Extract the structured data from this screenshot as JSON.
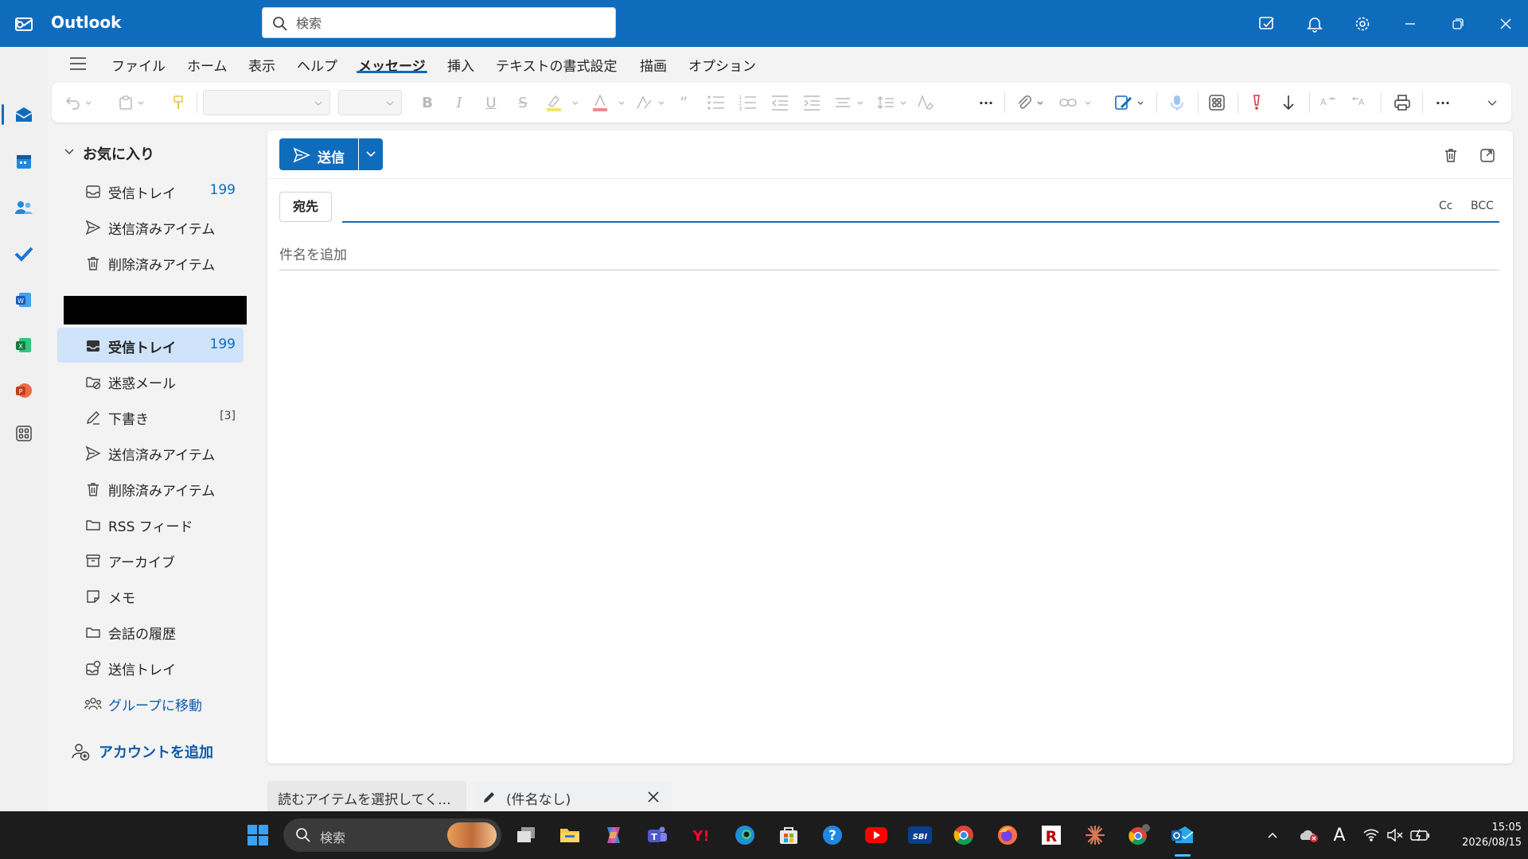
{
  "app": {
    "name": "Outlook",
    "accent": "#0f6cbd"
  },
  "search": {
    "placeholder": "検索"
  },
  "titlebar_buttons": [
    "compose-icon",
    "bell-icon",
    "gear-icon",
    "minimize-icon",
    "restore-icon",
    "close-icon"
  ],
  "rail": [
    "mail-icon",
    "calendar-icon",
    "people-icon",
    "todo-icon",
    "word-icon",
    "excel-icon",
    "powerpoint-icon",
    "apps-icon"
  ],
  "menu": {
    "tabs": [
      "ファイル",
      "ホーム",
      "表示",
      "ヘルプ",
      "メッセージ",
      "挿入",
      "テキストの書式設定",
      "描画",
      "オプション"
    ],
    "active": "メッセージ"
  },
  "folders": {
    "favorites_label": "お気に入り",
    "favorites": [
      {
        "label": "受信トレイ",
        "count": "199"
      },
      {
        "label": "送信済みアイテム"
      },
      {
        "label": "削除済みアイテム"
      }
    ],
    "account_items": [
      {
        "label": "受信トレイ",
        "count": "199",
        "selected": true
      },
      {
        "label": "迷惑メール"
      },
      {
        "label": "下書き",
        "count": "[3]"
      },
      {
        "label": "送信済みアイテム"
      },
      {
        "label": "削除済みアイテム"
      },
      {
        "label": "RSS フィード"
      },
      {
        "label": "アーカイブ"
      },
      {
        "label": "メモ"
      },
      {
        "label": "会話の履歴"
      },
      {
        "label": "送信トレイ"
      },
      {
        "label": "グループに移動"
      }
    ],
    "add_account": "アカウントを追加"
  },
  "compose": {
    "send_label": "送信",
    "to_label": "宛先",
    "cc_label": "Cc",
    "bcc_label": "BCC",
    "subject_placeholder": "件名を追加"
  },
  "bottom_tabs": [
    {
      "label": "読むアイテムを選択してく..."
    },
    {
      "label": "(件名なし)"
    }
  ],
  "taskbar": {
    "search_label": "検索",
    "time": "15:05",
    "date": "2026/08/15",
    "ime": "A"
  }
}
